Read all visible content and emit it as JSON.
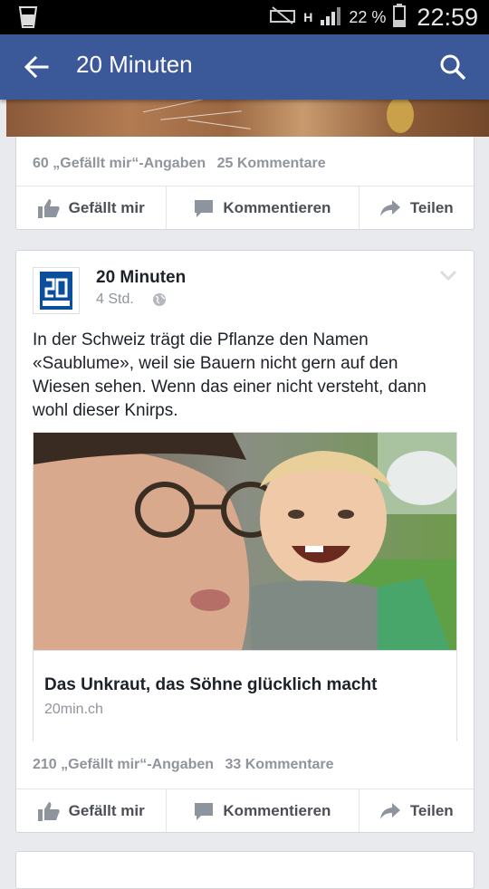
{
  "status_bar": {
    "battery_percent": "22 %",
    "time": "22:59",
    "network": "H"
  },
  "app_bar": {
    "title": "20 Minuten"
  },
  "post_previous": {
    "likes": "60 „Gefällt mir“-Angaben",
    "comments": "25 Kommentare",
    "actions": {
      "like": "Gefällt mir",
      "comment": "Kommentieren",
      "share": "Teilen"
    }
  },
  "post": {
    "page_name": "20 Minuten",
    "time": "4 Std.",
    "text": "In der Schweiz trägt die Pflanze den Namen «Saublume», weil sie Bauern nicht gern auf den Wiesen sehen. Wenn das einer nicht versteht, dann wohl dieser Knirps.",
    "link": {
      "title": "Das Unkraut, das Söhne glücklich macht",
      "domain": "20min.ch"
    },
    "likes": "210 „Gefällt mir“-Angaben",
    "comments": "33 Kommentare",
    "actions": {
      "like": "Gefällt mir",
      "comment": "Kommentieren",
      "share": "Teilen"
    }
  },
  "colors": {
    "brand": "#3b5998",
    "background": "#e9eaed",
    "meta_text": "#90949c"
  }
}
